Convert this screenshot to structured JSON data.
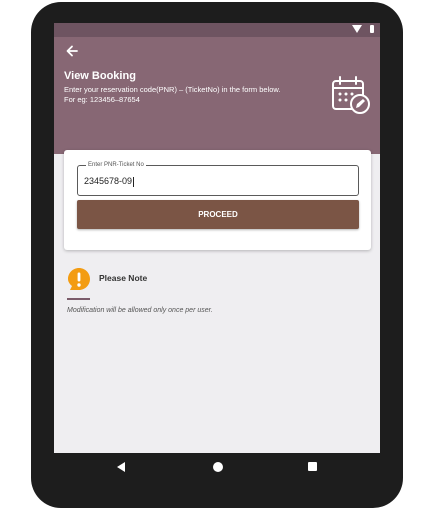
{
  "header": {
    "title": "View Booking",
    "subtitle": "Enter your reservation code(PNR) – (TicketNo) in the form below. For eg: 123456–87654"
  },
  "form": {
    "field_label": "Enter PNR-Ticket No",
    "field_value": "2345678-09",
    "proceed_label": "PROCEED"
  },
  "note": {
    "title": "Please Note",
    "text": "Modification will be allowed only once per user."
  },
  "icons": {
    "back": "arrow-left-icon",
    "calendar": "calendar-edit-icon",
    "note": "alert-icon",
    "wifi": "wifi-icon",
    "battery": "battery-icon"
  },
  "colors": {
    "appbar": "#876774",
    "statusbar": "#6e5461",
    "button": "#7b5545",
    "note_icon": "#f39c12"
  }
}
